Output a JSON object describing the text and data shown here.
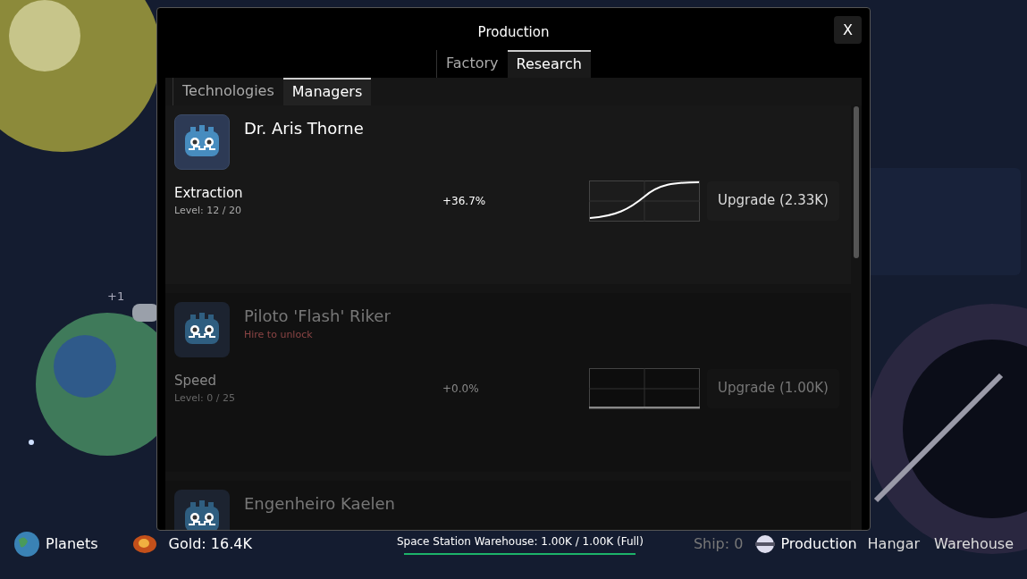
{
  "scene": {
    "floating_text": "+1"
  },
  "dialog": {
    "title": "Production",
    "close": "X",
    "tabs": [
      {
        "label": "Factory",
        "selected": false
      },
      {
        "label": "Research",
        "selected": true
      }
    ],
    "subtabs": [
      {
        "label": "Technologies",
        "selected": false
      },
      {
        "label": "Managers",
        "selected": true
      }
    ],
    "managers": [
      {
        "name": "Dr. Aris Thorne",
        "locked": false,
        "stat": "Extraction",
        "level_text": "Level: 12 / 20",
        "bonus": "+36.7%",
        "upgrade": "Upgrade (2.33K)"
      },
      {
        "name": "Piloto 'Flash' Riker",
        "locked": true,
        "hint": "Hire to unlock",
        "stat": "Speed",
        "level_text": "Level: 0 / 25",
        "bonus": "+0.0%",
        "upgrade": "Upgrade (1.00K)"
      },
      {
        "name": "Engenheiro Kaelen",
        "locked": true
      }
    ]
  },
  "bottom_bar": {
    "planets": "Planets",
    "gold": "Gold: 16.4K",
    "warehouse_status": "Space Station Warehouse: 1.00K / 1.00K (Full)",
    "level": 1.0,
    "ship": "Ship: 0",
    "production": "Production",
    "hangar": "Hangar",
    "warehouse": "Warehouse"
  }
}
